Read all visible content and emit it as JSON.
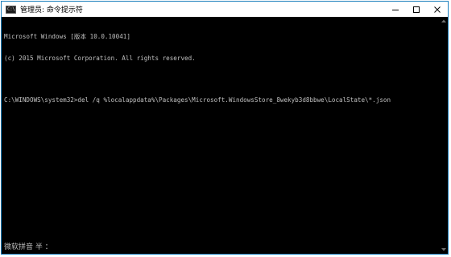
{
  "window": {
    "title": "管理员: 命令提示符",
    "icon": "cmd-icon",
    "icon_text": "C:\\"
  },
  "controls": {
    "minimize_icon": "minimize-icon",
    "maximize_icon": "maximize-icon",
    "close_icon": "close-icon"
  },
  "console": {
    "lines": [
      "Microsoft Windows [版本 10.0.10041]",
      "(c) 2015 Microsoft Corporation. All rights reserved.",
      "",
      "C:\\WINDOWS\\system32>del /q %localappdata%\\Packages\\Microsoft.WindowsStore_8wekyb3d8bbwe\\LocalState\\*.json"
    ],
    "ime_status": "微软拼音 半 ："
  }
}
